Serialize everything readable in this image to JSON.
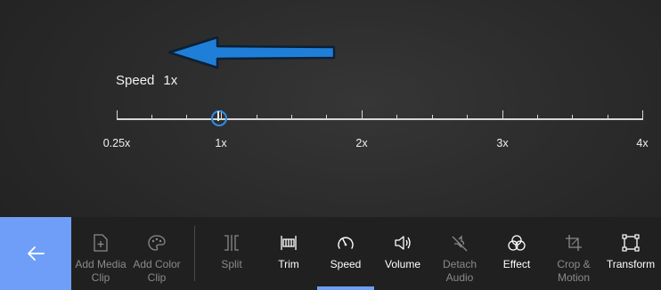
{
  "speed": {
    "label": "Speed",
    "value": "1x",
    "ticks": [
      "0.25x",
      "1x",
      "2x",
      "3x",
      "4x"
    ]
  },
  "toolbar": {
    "accent": "#6f9ef8",
    "items": [
      {
        "label": "Add Media\nClip",
        "icon": "add-media-icon",
        "state": "disabled"
      },
      {
        "label": "Add Color\nClip",
        "icon": "palette-icon",
        "state": "disabled"
      },
      {
        "label": "Split",
        "icon": "split-icon",
        "state": "disabled"
      },
      {
        "label": "Trim",
        "icon": "trim-icon",
        "state": "enabled"
      },
      {
        "label": "Speed",
        "icon": "speedometer-icon",
        "state": "selected"
      },
      {
        "label": "Volume",
        "icon": "volume-icon",
        "state": "enabled"
      },
      {
        "label": "Detach\nAudio",
        "icon": "detach-audio-icon",
        "state": "disabled"
      },
      {
        "label": "Effect",
        "icon": "effect-icon",
        "state": "enabled"
      },
      {
        "label": "Crop &\nMotion",
        "icon": "crop-icon",
        "state": "disabled"
      },
      {
        "label": "Transform",
        "icon": "transform-icon",
        "state": "enabled"
      }
    ]
  }
}
